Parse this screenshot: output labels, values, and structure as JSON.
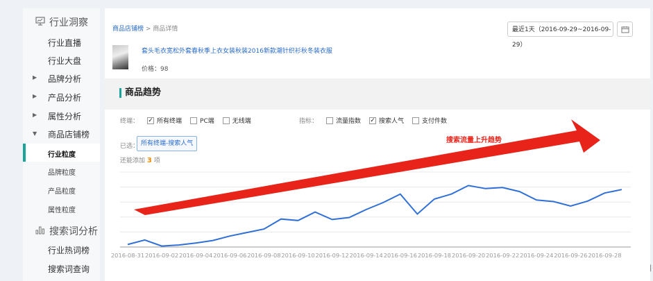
{
  "sidebar": {
    "section1": {
      "title": "行业洞察",
      "icon": "monitor-icon"
    },
    "items": [
      {
        "label": "行业直播",
        "expander": false
      },
      {
        "label": "行业大盘",
        "expander": false
      },
      {
        "label": "品牌分析",
        "expander": true
      },
      {
        "label": "产品分析",
        "expander": true
      },
      {
        "label": "属性分析",
        "expander": true
      },
      {
        "label": "商品店铺榜",
        "expander": true,
        "expanded": true
      }
    ],
    "subitems": [
      {
        "label": "行业粒度",
        "active": true
      },
      {
        "label": "品牌粒度"
      },
      {
        "label": "产品粒度"
      },
      {
        "label": "属性粒度"
      }
    ],
    "section2": {
      "title": "搜索词分析",
      "icon": "bar-chart-icon"
    },
    "items2": [
      {
        "label": "行业热词榜"
      },
      {
        "label": "搜索词查询"
      }
    ]
  },
  "breadcrumb": {
    "link": "商品店铺榜",
    "sep": ">",
    "current": "商品详情"
  },
  "date_range": "最近1天（2016-09-29~2016-09-29）",
  "product": {
    "title": "套头毛衣宽松外套春秋季上衣女装秋装2016新款潮针织衫秋冬装衣服",
    "price_label": "价格：98"
  },
  "trend": {
    "title": "商品趋势"
  },
  "filters": {
    "terminal": {
      "label": "终端：",
      "options": [
        {
          "label": "所有终端",
          "checked": true
        },
        {
          "label": "PC端",
          "checked": false
        },
        {
          "label": "无线端",
          "checked": false
        }
      ]
    },
    "metric": {
      "label": "指标：",
      "options": [
        {
          "label": "流量指数",
          "checked": false
        },
        {
          "label": "搜索人气",
          "checked": true
        },
        {
          "label": "支付件数",
          "checked": false
        }
      ]
    }
  },
  "selected": {
    "label": "已选：",
    "tag": "所有终端-搜索人气"
  },
  "add_more": {
    "prefix": "还能添加",
    "count": "3",
    "suffix": "项"
  },
  "annotation": "搜索流量上升趋势",
  "colors": {
    "line": "#2f6fd6",
    "arrow": "#e8231a",
    "accent": "#1aa39a"
  },
  "chart_data": {
    "type": "line",
    "x_tick_labels": [
      "2016-08-31",
      "2016-09-02",
      "2016-09-04",
      "2016-09-06",
      "2016-09-08",
      "2016-09-10",
      "2016-09-12",
      "2016-09-14",
      "2016-09-16",
      "2016-09-18",
      "2016-09-20",
      "2016-09-22",
      "2016-09-24",
      "2016-09-26",
      "2016-09-28"
    ],
    "x": [
      "2016-08-31",
      "2016-09-01",
      "2016-09-02",
      "2016-09-03",
      "2016-09-04",
      "2016-09-05",
      "2016-09-06",
      "2016-09-07",
      "2016-09-08",
      "2016-09-09",
      "2016-09-10",
      "2016-09-11",
      "2016-09-12",
      "2016-09-13",
      "2016-09-14",
      "2016-09-15",
      "2016-09-16",
      "2016-09-17",
      "2016-09-18",
      "2016-09-19",
      "2016-09-20",
      "2016-09-21",
      "2016-09-22",
      "2016-09-23",
      "2016-09-24",
      "2016-09-25",
      "2016-09-26",
      "2016-09-27",
      "2016-09-28",
      "2016-09-29"
    ],
    "values": [
      0.5,
      1.4,
      0.2,
      0.4,
      0.8,
      1.3,
      2.2,
      2.9,
      3.6,
      5.6,
      5.3,
      7.0,
      5.5,
      5.9,
      7.5,
      8.9,
      10.6,
      6.6,
      9.6,
      10.6,
      12.3,
      11.7,
      11.9,
      11.1,
      9.4,
      9.1,
      8.2,
      9.2,
      10.8,
      11.5
    ],
    "ylim": [
      0,
      15
    ],
    "grid": true
  }
}
